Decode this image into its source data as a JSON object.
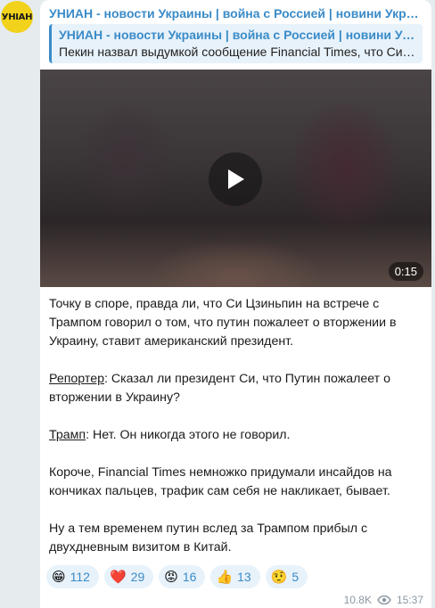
{
  "avatar": {
    "text": "УНІАН",
    "color": "#f2d21b"
  },
  "channel": {
    "name": "УНИАН - новости Украины | война с Россией | новини Україні…"
  },
  "reply": {
    "title": "УНИАН - новости Украины | война с Россией | новини Украї…",
    "text": "Пекин назвал выдумкой сообщение Financial Times, что Си …"
  },
  "video": {
    "duration": "0:15",
    "play_icon": "play-icon"
  },
  "post": {
    "p1": "Точку в споре, правда ли, что Си Цзиньпин на встрече с Трампом говорил о том, что путин пожалеет о вторжении в Украину, ставит американский президент.",
    "reporter_label": "Репортер",
    "reporter_text": ": Сказал ли президент Си, что Путин пожалеет о вторжении в Украину?",
    "trump_label": "Трамп",
    "trump_text": ": Нет. Он никогда этого не говорил.",
    "p4": "Короче, Financial Times немножко придумали инсайдов на кончиках пальцев, трафик сам себя не накликает, бывает.",
    "p5": "Ну а тем временем путин вслед за Трампом прибыл с двухдневным визитом в Китай."
  },
  "reactions": [
    {
      "emoji": "😁",
      "count": "112"
    },
    {
      "emoji": "❤️",
      "count": "29"
    },
    {
      "emoji": "😡",
      "count": "16"
    },
    {
      "emoji": "👍",
      "count": "13"
    },
    {
      "emoji": "🤨",
      "count": "5"
    }
  ],
  "meta": {
    "views": "10.8K",
    "time": "15:37",
    "views_icon": "eye-icon"
  },
  "colors": {
    "accent": "#3a8bc8",
    "reaction_bg": "#e8f2fa",
    "background": "#e6ebee"
  }
}
